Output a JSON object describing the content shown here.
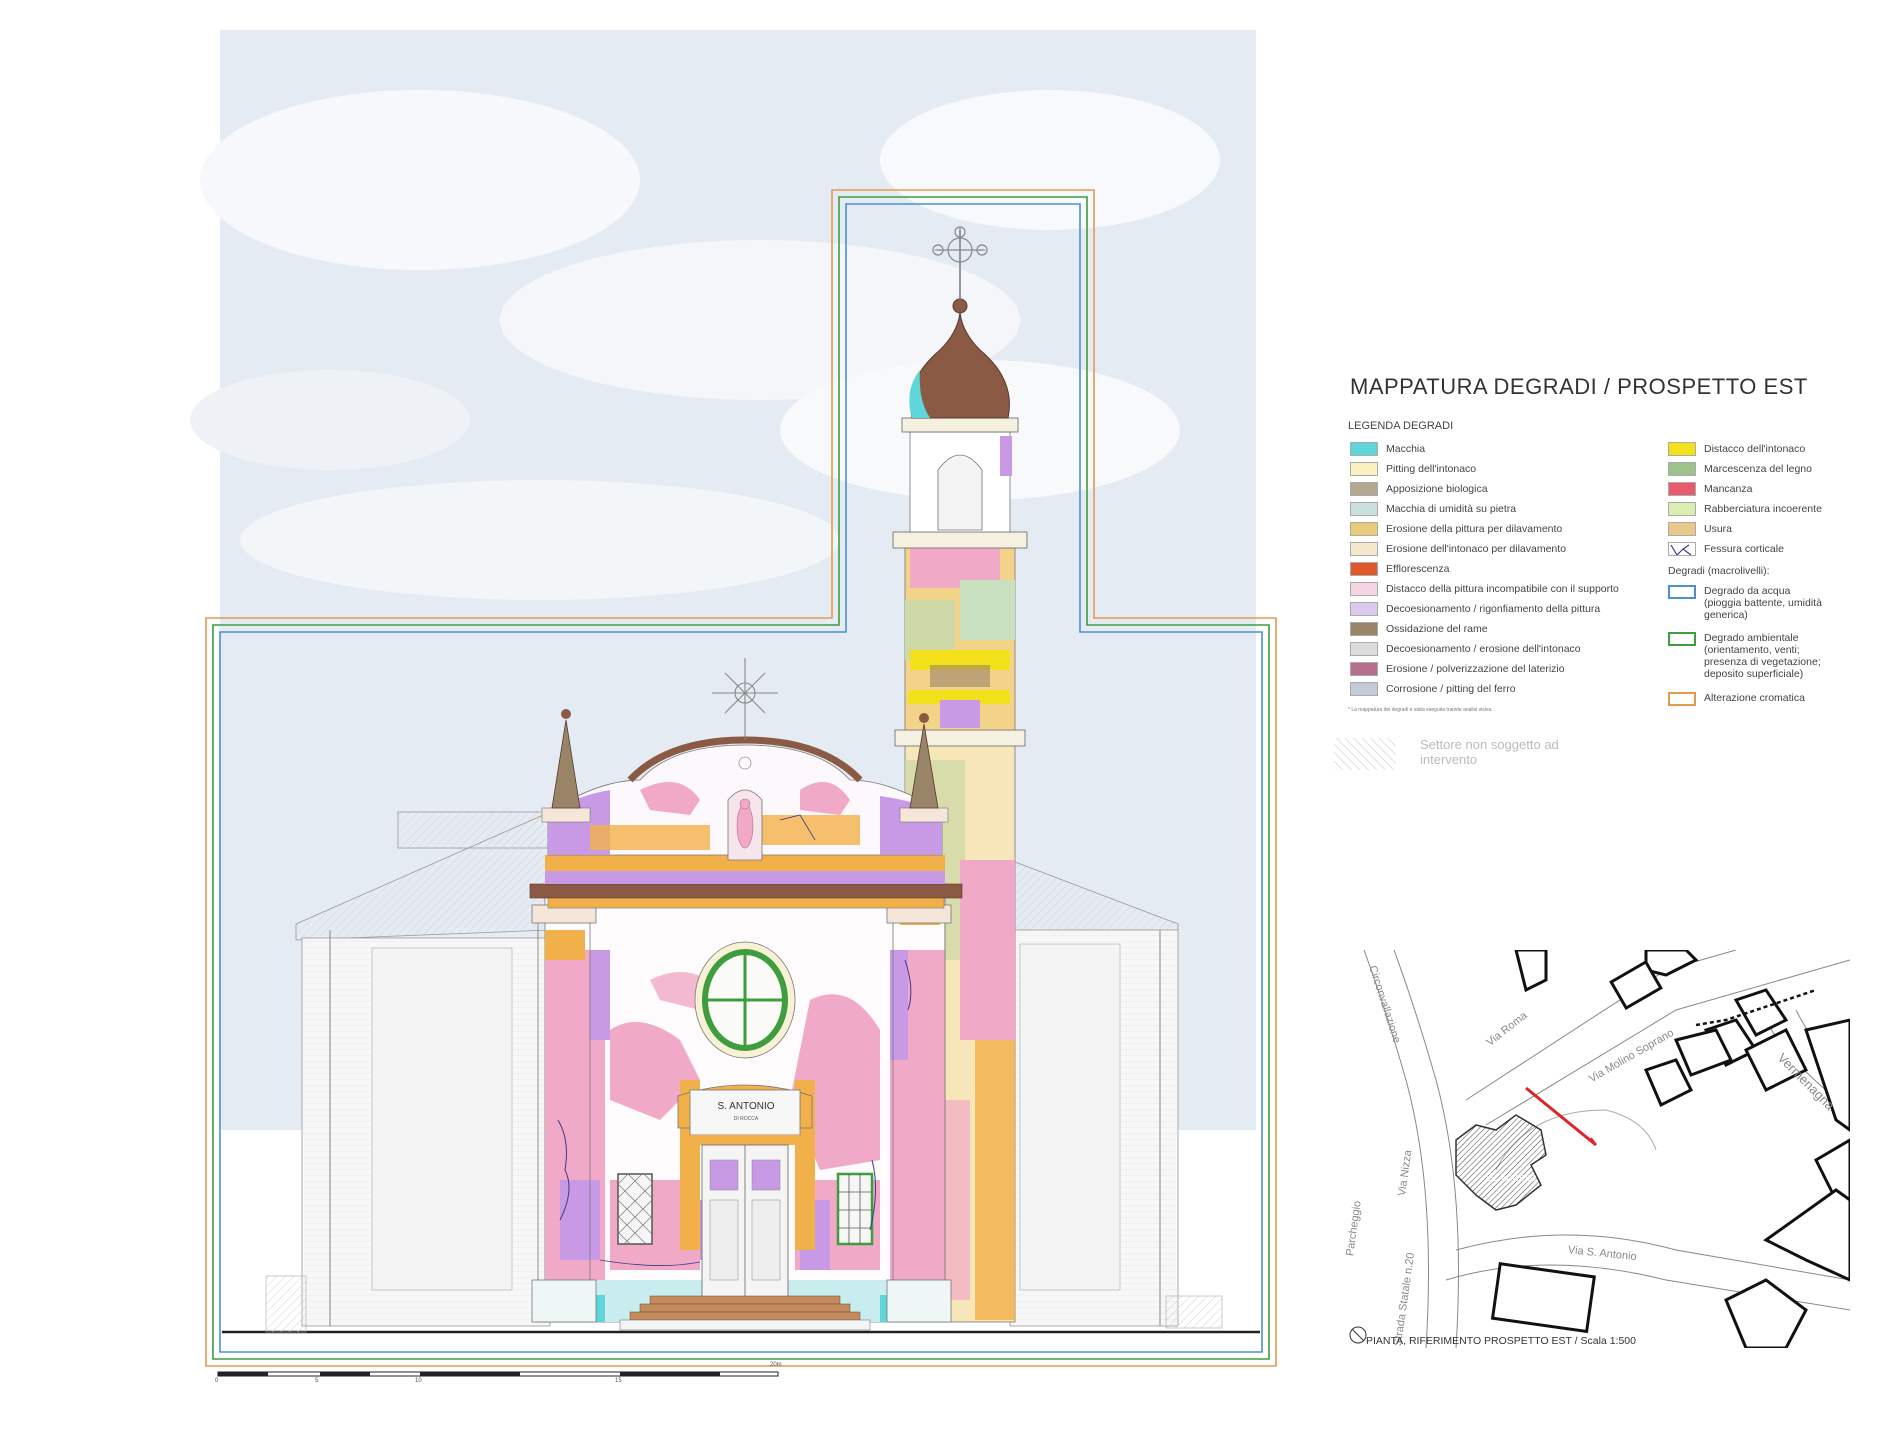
{
  "title": "MAPPATURA DEGRADI / PROSPETTO EST",
  "legend": {
    "heading": "LEGENDA DEGRADI",
    "left_items": [
      {
        "label": "Macchia",
        "color": "#5fd6d9"
      },
      {
        "label": "Pitting dell'intonaco",
        "color": "#fbf1c0"
      },
      {
        "label": "Apposizione biologica",
        "color": "#b5a890"
      },
      {
        "label": "Macchia di umidità su pietra",
        "color": "#c9dedd"
      },
      {
        "label": "Erosione della pittura per dilavamento",
        "color": "#e9c97a"
      },
      {
        "label": "Erosione dell'intonaco per dilavamento",
        "color": "#f3e8cc"
      },
      {
        "label": "Efflorescenza",
        "color": "#e0582a"
      },
      {
        "label": "Distacco della pittura incompatibile con il supporto",
        "color": "#f5d5e3"
      },
      {
        "label": "Decoesionamento / rigonfiamento della pittura",
        "color": "#dcc9ee"
      },
      {
        "label": "Ossidazione del rame",
        "color": "#9a8468"
      },
      {
        "label": "Decoesionamento / erosione dell'intonaco",
        "color": "#dcdcdc"
      },
      {
        "label": "Erosione / polverizzazione del laterizio",
        "color": "#b76e8c"
      },
      {
        "label": "Corrosione / pitting del ferro",
        "color": "#c3ccd6"
      }
    ],
    "right_items": [
      {
        "label": "Distacco dell'intonaco",
        "color": "#f2e01a"
      },
      {
        "label": "Marcescenza del legno",
        "color": "#9cc48a"
      },
      {
        "label": "Mancanza",
        "color": "#e85a6d"
      },
      {
        "label": "Rabberciatura incoerente",
        "color": "#d9eeb0"
      },
      {
        "label": "Usura",
        "color": "#e9c989"
      },
      {
        "label": "Fessura corticale",
        "color": "#ffffff"
      }
    ],
    "macro_heading": "Degradi (macrolivelli):",
    "macro_items": [
      {
        "label": "Degrado da acqua (pioggia battente, umidità generica)",
        "color": "#4b8fd6"
      },
      {
        "label": "Degrado ambientale (orientamento, venti; presenza di vegetazione; deposito superficiale)",
        "color": "#3f9c3f"
      },
      {
        "label": "Alterazione cromatica",
        "color": "#e39a4c"
      }
    ],
    "footnote": "* La mappatura dei degradi è stata eseguita tramite analisi visiva.",
    "sector_label": "Settore non soggetto ad intervento"
  },
  "facade": {
    "sign_line1": "S. ANTONIO",
    "sign_line2": "DI ROCCA"
  },
  "site_plan": {
    "caption": "PIANTA, RIFERIMENTO PROSPETTO EST / Scala 1:500",
    "streets": [
      "Circonvallazione",
      "Via Roma",
      "Via Molino Soprano",
      "Vermenagna",
      "Via Nizza",
      "Parcheggio",
      "Strada Statale n.20",
      "Via S. Antonio"
    ],
    "building_label": "S. Antonio"
  },
  "scale_bar": {
    "labels": [
      "0",
      "5",
      "10",
      "15",
      "20m"
    ]
  },
  "colors": {
    "macro_orange": "#e39a4c",
    "macro_green": "#3f9c3f",
    "macro_blue": "#4b8fd6",
    "sky": "#e3e8f0",
    "roof_brown": "#8a5a45",
    "pink": "#f0a9c6",
    "purple": "#c89ae6",
    "orange": "#f2b04a"
  }
}
